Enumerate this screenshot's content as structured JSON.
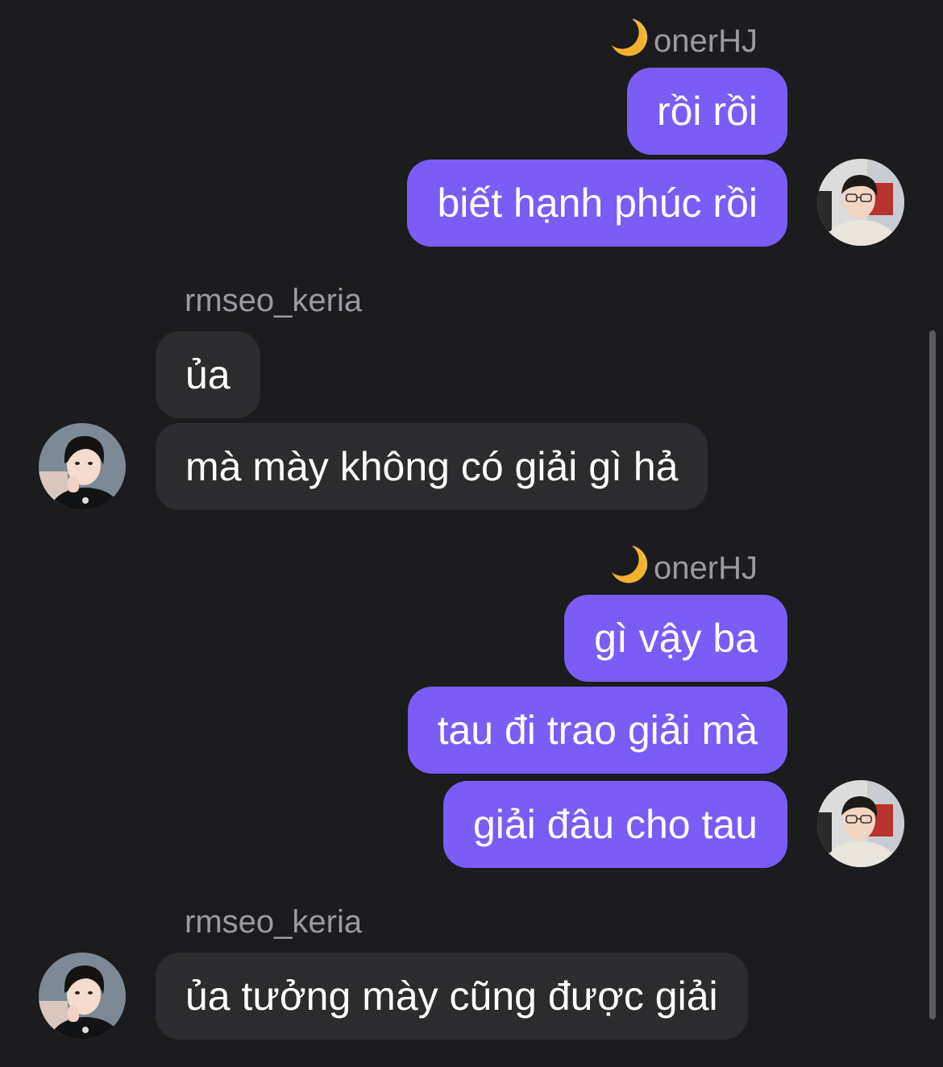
{
  "colors": {
    "background": "#1c1c1e",
    "outgoing_bubble": "#7b5cf7",
    "incoming_bubble": "#2c2c2e",
    "sender_name": "#9a9a9f",
    "text": "#ffffff"
  },
  "groups": [
    {
      "sender": "onerHJ",
      "sender_prefix_icon": "crescent-moon-icon",
      "direction": "outgoing",
      "messages": [
        "rồi rồi",
        "biết hạnh phúc rồi"
      ]
    },
    {
      "sender": "rmseo_keria",
      "direction": "incoming",
      "messages": [
        "ủa",
        "mà mày không có giải gì hả"
      ]
    },
    {
      "sender": "onerHJ",
      "sender_prefix_icon": "crescent-moon-icon",
      "direction": "outgoing",
      "messages": [
        "gì vậy ba",
        "tau đi trao giải mà",
        "giải đâu cho tau"
      ]
    },
    {
      "sender": "rmseo_keria",
      "direction": "incoming",
      "messages": [
        "ủa tưởng mày cũng được giải"
      ]
    }
  ]
}
